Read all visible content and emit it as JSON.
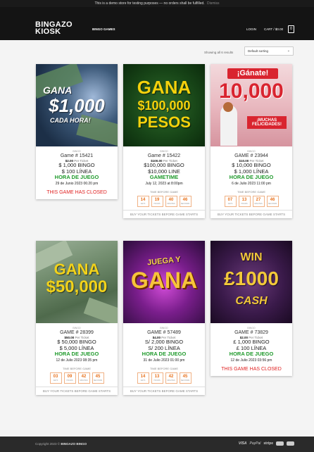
{
  "demo_notice": {
    "text": "This is a demo store for testing purposes — no orders shall be fulfilled.",
    "dismiss": "Dismiss"
  },
  "header": {
    "logo_line1": "BINGAZO",
    "logo_line2": "KIOSK",
    "nav_games": "BINGO GAMES",
    "login": "LOGIN",
    "cart": "CART / $0.00",
    "cart_count": "0"
  },
  "toolbar": {
    "results": "Showing all 6 results",
    "sort": "Default sorting"
  },
  "products": [
    {
      "promo_l1": "GANA",
      "promo_l2": "$1,000",
      "promo_l3": "CADA HORA!",
      "category": "BINGO",
      "name": "Game # 15421",
      "price": "$2.00",
      "per": "Per Ticket",
      "prize1": "$ 1,000 BINGO",
      "prize2": "$ 100 LÍNEA",
      "hora": "HORA DE JUEGO",
      "date": "29 de Junio 2023 06:20 pm",
      "closed": "THIS GAME HAS CLOSED"
    },
    {
      "promo_l1": "GANA",
      "promo_l2": "$100,000",
      "promo_l3": "PESOS",
      "category": "BINGO",
      "name": "Game # 15422",
      "price": "$100.00",
      "per": "Per Ticket",
      "prize1": "$100,000 BINGO",
      "prize2": "$10,000 LINE",
      "hora": "GAMETIME",
      "date": "July 12, 2023 at 8:00pm",
      "tbg": "TIME BEFORE GAME",
      "countdown": [
        {
          "num": "14",
          "unit": "DAYS"
        },
        {
          "num": "19",
          "unit": "HOURS"
        },
        {
          "num": "40",
          "unit": "MINUTES"
        },
        {
          "num": "46",
          "unit": "SECONDS"
        }
      ],
      "buy": "BUY YOUR TICKETS BEFORE GAME STARTS"
    },
    {
      "promo_l1": "¡Gánate!",
      "promo_l2": "10,000",
      "promo_l3": "¡MUCHAS FELICIDADES!",
      "category": "BINGO",
      "name": "GAME # 23944",
      "price": "$10.00",
      "per": "Per Ticket",
      "prize1": "$ 10,000 BINGO",
      "prize2": "$ 1,000 LÍNEA",
      "hora": "HORA DE JUEGO",
      "date": "6 de Julio 2023 11:00 pm",
      "tbg": "TIME BEFORE GAME",
      "countdown": [
        {
          "num": "07",
          "unit": "DAYS"
        },
        {
          "num": "13",
          "unit": "HOURS"
        },
        {
          "num": "27",
          "unit": "MINUTES"
        },
        {
          "num": "46",
          "unit": "SECONDS"
        }
      ],
      "buy": "BUY YOUR TICKETS BEFORE GAME STARTS"
    },
    {
      "promo_l1": "GANA",
      "promo_l2": "$50,000",
      "promo_l3": "",
      "category": "BINGO",
      "name": "GAME # 28399",
      "price": "$50.00",
      "per": "Per Ticket",
      "prize1": "$ 50,000 BINGO",
      "prize2": "$ 5,000 LÍNEA",
      "hora": "HORA DE JUEGO",
      "date": "12 de Julio 2023 08:35 pm",
      "tbg": "TIME BEFORE GAME",
      "countdown": [
        {
          "num": "03",
          "unit": "DAYS"
        },
        {
          "num": "09",
          "unit": "HOURS"
        },
        {
          "num": "42",
          "unit": "MINUTES"
        },
        {
          "num": "45",
          "unit": "SECONDS"
        }
      ],
      "buy": "BUY YOUR TICKETS BEFORE GAME STARTS"
    },
    {
      "promo_l1": "JUEGA Y",
      "promo_l2": "GANA",
      "promo_l3": "",
      "category": "BINGO",
      "name": "GAME # 57489",
      "price": "$4.00",
      "per": "Per Ticket",
      "prize1": "S/ 2,000 BINGO",
      "prize2": "S/ 200 LÍNEA",
      "hora": "HORA DE JUEGO",
      "date": "31 de Julio 2023 01:00 pm",
      "tbg": "TIME BEFORE GAME",
      "countdown": [
        {
          "num": "14",
          "unit": "DAYS"
        },
        {
          "num": "13",
          "unit": "HOURS"
        },
        {
          "num": "42",
          "unit": "MINUTES"
        },
        {
          "num": "45",
          "unit": "SECONDS"
        }
      ],
      "buy": "BUY YOUR TICKETS BEFORE GAME STARTS"
    },
    {
      "promo_l1": "WIN",
      "promo_l2": "£1000",
      "promo_l3": "CASH",
      "category": "BINGO",
      "name": "GAME # 73829",
      "price": "$2.00",
      "per": "Per Ticket",
      "prize1": "£ 1,000 BINGO",
      "prize2": "£ 100 LÍNEA",
      "hora": "HORA DE JUEGO",
      "date": "12 de Julio 2023 03:56 pm",
      "closed": "THIS GAME HAS CLOSED"
    }
  ],
  "footer": {
    "copyright": "Copyright 2023 ©",
    "brand": "BINGAZO BINGO",
    "payments": [
      "VISA",
      "PayPal",
      "stripe"
    ]
  }
}
